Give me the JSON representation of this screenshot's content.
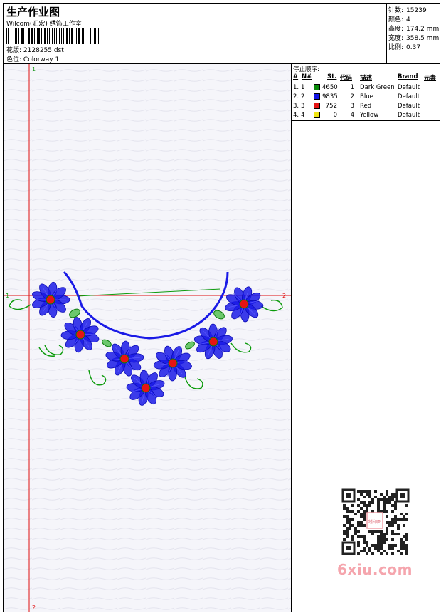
{
  "header": {
    "title": "生产作业图",
    "subtitle": "Wilcom(汇宏) 绣饰工作室",
    "file_label": "花版:",
    "file_value": "2128255.dst",
    "color_label": "色位:",
    "color_value": "Colorway 1"
  },
  "stats": [
    {
      "label": "针数:",
      "value": "15239"
    },
    {
      "label": "颜色:",
      "value": "4"
    },
    {
      "label": "高度:",
      "value": "174.2 mm"
    },
    {
      "label": "宽度:",
      "value": "358.5 mm"
    },
    {
      "label": "比例:",
      "value": "0.37"
    }
  ],
  "stop_sequence": {
    "title": "停止顺序:",
    "headers": {
      "num": "#",
      "n": "N#",
      "stitches": "St.",
      "code": "代码",
      "desc": "描述",
      "brand": "Brand",
      "element": "元素"
    },
    "rows": [
      {
        "num": "1.",
        "n": "1",
        "color": "#0a8a0a",
        "stitches": "4650",
        "code": "1",
        "desc": "Dark Green",
        "brand": "Default"
      },
      {
        "num": "2.",
        "n": "2",
        "color": "#1414e6",
        "stitches": "9835",
        "code": "2",
        "desc": "Blue",
        "brand": "Default"
      },
      {
        "num": "3.",
        "n": "3",
        "color": "#e61414",
        "stitches": "752",
        "code": "3",
        "desc": "Red",
        "brand": "Default"
      },
      {
        "num": "4.",
        "n": "4",
        "color": "#f0e614",
        "stitches": "0",
        "code": "4",
        "desc": "Yellow",
        "brand": "Default"
      }
    ]
  },
  "axis_labels": {
    "h_left": "1",
    "h_right": "2",
    "v_top": "1",
    "v_bottom": "2"
  },
  "colors": {
    "axis": "#e01010",
    "green": "#0a9a0a",
    "blue": "#1a1ae6",
    "red": "#e61414"
  },
  "watermark": "6xiu.com",
  "qr_badge": "绣印图"
}
